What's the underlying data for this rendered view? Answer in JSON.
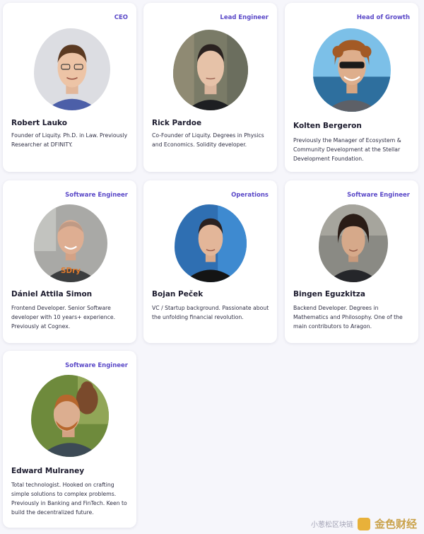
{
  "team": [
    {
      "role": "CEO",
      "name": "Robert Lauko",
      "bio": "Founder of Liquity. Ph.D. in Law. Previously Researcher at DFINITY."
    },
    {
      "role": "Lead Engineer",
      "name": "Rick Pardoe",
      "bio": "Co-Founder of Liquity. Degrees in Physics and Economics. Solidity developer."
    },
    {
      "role": "Head of Growth",
      "name": "Kolten Bergeron",
      "bio": "Previously the Manager of Ecosystem & Community Development at the Stellar Development Foundation."
    },
    {
      "role": "Software Engineer",
      "name": "Dániel Attila Simon",
      "bio": "Frontend Developer. Senior Software developer with 10 years+ experience. Previously at Cognex."
    },
    {
      "role": "Operations",
      "name": "Bojan Peček",
      "bio": "VC / Startup background. Passionate about the unfolding financial revolution."
    },
    {
      "role": "Software Engineer",
      "name": "Bingen Eguzkitza",
      "bio": "Backend Developer. Degrees in Mathematics and Philosophy. One of the main contributors to Aragon."
    },
    {
      "role": "Software Engineer",
      "name": "Edward Mulraney",
      "bio": "Total technologist. Hooked on crafting simple solutions to complex problems. Previously in Banking and FinTech. Keen to build the decentralized future."
    }
  ],
  "watermark": {
    "line1": "小葱松区块链",
    "line2": "金色财经"
  }
}
